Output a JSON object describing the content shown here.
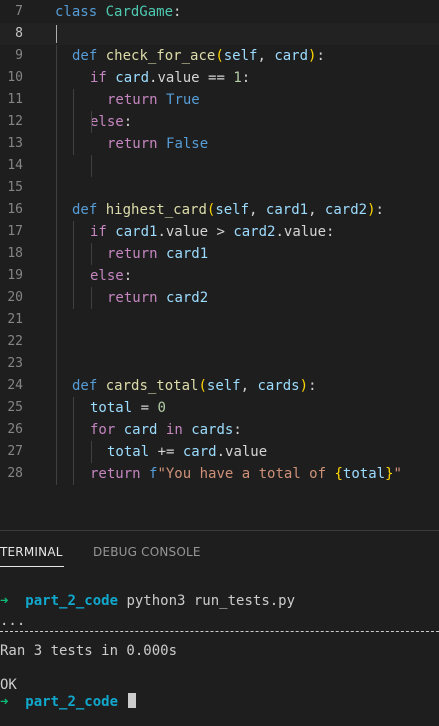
{
  "editor": {
    "lines": [
      {
        "n": "7",
        "tokens": [
          [
            "class",
            "kw"
          ],
          [
            " ",
            "plain"
          ],
          [
            "CardGame",
            "cls"
          ],
          [
            ":",
            "plain"
          ]
        ]
      },
      {
        "n": "8",
        "tokens": []
      },
      {
        "n": "9",
        "tokens": [
          [
            "def",
            "kw"
          ],
          [
            " ",
            "plain"
          ],
          [
            "check_for_ace",
            "fn"
          ],
          [
            "(",
            "paren"
          ],
          [
            "self",
            "var"
          ],
          [
            ", ",
            "plain"
          ],
          [
            "card",
            "var"
          ],
          [
            ")",
            "paren"
          ],
          [
            ":",
            "plain"
          ]
        ]
      },
      {
        "n": "10",
        "tokens": [
          [
            "if",
            "ctl"
          ],
          [
            " ",
            "plain"
          ],
          [
            "card",
            "var"
          ],
          [
            ".value == ",
            "plain"
          ],
          [
            "1",
            "num"
          ],
          [
            ":",
            "plain"
          ]
        ]
      },
      {
        "n": "11",
        "tokens": [
          [
            "return",
            "ctl"
          ],
          [
            " ",
            "plain"
          ],
          [
            "True",
            "kw"
          ]
        ]
      },
      {
        "n": "12",
        "tokens": [
          [
            "else",
            "ctl"
          ],
          [
            ":",
            "plain"
          ]
        ]
      },
      {
        "n": "13",
        "tokens": [
          [
            "return",
            "ctl"
          ],
          [
            " ",
            "plain"
          ],
          [
            "False",
            "kw"
          ]
        ]
      },
      {
        "n": "14",
        "tokens": []
      },
      {
        "n": "15",
        "tokens": []
      },
      {
        "n": "16",
        "tokens": [
          [
            "def",
            "kw"
          ],
          [
            " ",
            "plain"
          ],
          [
            "highest_card",
            "fn"
          ],
          [
            "(",
            "paren"
          ],
          [
            "self",
            "var"
          ],
          [
            ", ",
            "plain"
          ],
          [
            "card1",
            "var"
          ],
          [
            ", ",
            "plain"
          ],
          [
            "card2",
            "var"
          ],
          [
            ")",
            "paren"
          ],
          [
            ":",
            "plain"
          ]
        ]
      },
      {
        "n": "17",
        "tokens": [
          [
            "if",
            "ctl"
          ],
          [
            " ",
            "plain"
          ],
          [
            "card1",
            "var"
          ],
          [
            ".value > ",
            "plain"
          ],
          [
            "card2",
            "var"
          ],
          [
            ".value:",
            "plain"
          ]
        ]
      },
      {
        "n": "18",
        "tokens": [
          [
            "return",
            "ctl"
          ],
          [
            " ",
            "plain"
          ],
          [
            "card1",
            "var"
          ]
        ]
      },
      {
        "n": "19",
        "tokens": [
          [
            "else",
            "ctl"
          ],
          [
            ":",
            "plain"
          ]
        ]
      },
      {
        "n": "20",
        "tokens": [
          [
            "return",
            "ctl"
          ],
          [
            " ",
            "plain"
          ],
          [
            "card2",
            "var"
          ]
        ]
      },
      {
        "n": "21",
        "tokens": []
      },
      {
        "n": "22",
        "tokens": []
      },
      {
        "n": "23",
        "tokens": []
      },
      {
        "n": "24",
        "tokens": [
          [
            "def",
            "kw"
          ],
          [
            " ",
            "plain"
          ],
          [
            "cards_total",
            "fn"
          ],
          [
            "(",
            "paren"
          ],
          [
            "self",
            "var"
          ],
          [
            ", ",
            "plain"
          ],
          [
            "cards",
            "var"
          ],
          [
            ")",
            "paren"
          ],
          [
            ":",
            "plain"
          ]
        ]
      },
      {
        "n": "25",
        "tokens": [
          [
            "total",
            "var"
          ],
          [
            " = ",
            "plain"
          ],
          [
            "0",
            "num"
          ]
        ]
      },
      {
        "n": "26",
        "tokens": [
          [
            "for",
            "ctl"
          ],
          [
            " ",
            "plain"
          ],
          [
            "card",
            "var"
          ],
          [
            " ",
            "plain"
          ],
          [
            "in",
            "ctl"
          ],
          [
            " ",
            "plain"
          ],
          [
            "cards",
            "var"
          ],
          [
            ":",
            "plain"
          ]
        ]
      },
      {
        "n": "27",
        "tokens": [
          [
            "total",
            "var"
          ],
          [
            " += ",
            "plain"
          ],
          [
            "card",
            "var"
          ],
          [
            ".value",
            "plain"
          ]
        ]
      },
      {
        "n": "28",
        "tokens": [
          [
            "return",
            "ctl"
          ],
          [
            " ",
            "plain"
          ],
          [
            "f",
            "kw"
          ],
          [
            "\"You have a total of ",
            "str"
          ],
          [
            "{",
            "brace"
          ],
          [
            "total",
            "var"
          ],
          [
            "}",
            "brace"
          ],
          [
            "\"",
            "str"
          ]
        ]
      }
    ],
    "active_line": "8"
  },
  "panel": {
    "tabs": [
      {
        "label": "TERMINAL",
        "active": true
      },
      {
        "label": "DEBUG CONSOLE",
        "active": false
      }
    ]
  },
  "terminal": {
    "prompt_arrow": "➜",
    "dir": "part_2_code",
    "command": "python3 run_tests.py",
    "dots": "...",
    "result": "Ran 3 tests in 0.000s",
    "status": "OK"
  },
  "colors": {
    "background": "#1e1e1e",
    "keyword": "#569cd6",
    "control": "#c586c0",
    "function": "#dcdcaa",
    "class": "#4ec9b0",
    "variable": "#9cdcfe",
    "number": "#b5cea8",
    "string": "#ce9178",
    "prompt_arrow": "#0dbc79",
    "prompt_dir": "#11a8cd"
  }
}
